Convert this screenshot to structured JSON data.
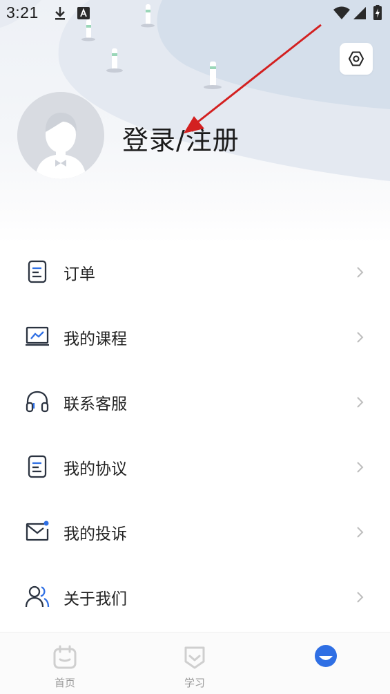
{
  "status_bar": {
    "time": "3:21",
    "icons": [
      "download-icon",
      "a-badge-icon",
      "wifi-icon",
      "cell-signal-icon",
      "battery-charging-icon"
    ]
  },
  "header": {
    "login_text": "登录/注册",
    "settings_icon": "settings-hexagon-icon",
    "avatar_icon": "default-avatar-icon"
  },
  "menu": {
    "items": [
      {
        "label": "订单",
        "icon": "document-icon"
      },
      {
        "label": "我的课程",
        "icon": "course-chart-icon"
      },
      {
        "label": "联系客服",
        "icon": "headset-icon"
      },
      {
        "label": "我的协议",
        "icon": "document-icon"
      },
      {
        "label": "我的投诉",
        "icon": "mail-icon"
      },
      {
        "label": "关于我们",
        "icon": "users-icon"
      }
    ]
  },
  "bottom_nav": {
    "items": [
      {
        "label": "首页",
        "icon": "calendar-icon"
      },
      {
        "label": "学习",
        "icon": "shield-icon"
      },
      {
        "label": "",
        "icon": "profile-face-icon",
        "active": true
      }
    ]
  },
  "colors": {
    "accent": "#2f6fe4",
    "text_primary": "#1c1c1c",
    "icon_stroke": "#2b3340",
    "chevron": "#bdbdbd",
    "nav_inactive": "#c8c8c8",
    "annotation_arrow": "#d32020"
  }
}
